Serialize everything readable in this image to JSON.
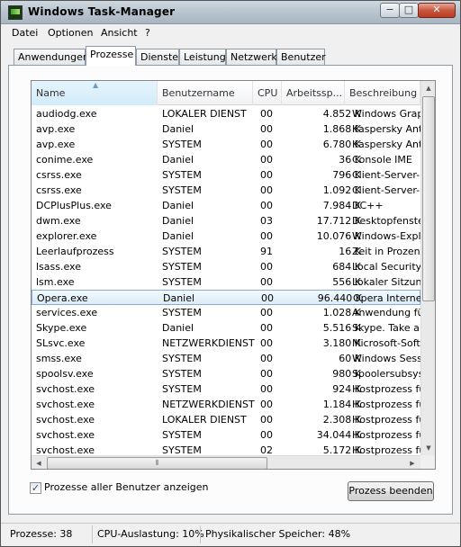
{
  "window": {
    "title": "Windows Task-Manager"
  },
  "caption": {
    "minimize": "−",
    "maximize": "□",
    "close": "✕"
  },
  "menu": [
    {
      "label": "Datei"
    },
    {
      "label": "Optionen"
    },
    {
      "label": "Ansicht"
    },
    {
      "label": "?"
    }
  ],
  "tabs": [
    {
      "label": "Anwendungen"
    },
    {
      "label": "Prozesse"
    },
    {
      "label": "Dienste"
    },
    {
      "label": "Leistung"
    },
    {
      "label": "Netzwerk"
    },
    {
      "label": "Benutzer"
    }
  ],
  "active_tab": "Prozesse",
  "columns": [
    "Name",
    "Benutzername",
    "CPU",
    "Arbeitssp...",
    "Beschreibung"
  ],
  "processes": [
    [
      "audiodg.exe",
      "LOKALER DIENST",
      "00",
      "4.852 K",
      "Windows Graphi"
    ],
    [
      "avp.exe",
      "Daniel",
      "00",
      "1.868 K",
      "Kaspersky Anti-V"
    ],
    [
      "avp.exe",
      "SYSTEM",
      "00",
      "6.780 K",
      "Kaspersky Anti-V"
    ],
    [
      "conime.exe",
      "Daniel",
      "00",
      "36 K",
      "Console IME"
    ],
    [
      "csrss.exe",
      "SYSTEM",
      "00",
      "796 K",
      "Client-Server-La"
    ],
    [
      "csrss.exe",
      "SYSTEM",
      "00",
      "1.092 K",
      "Client-Server-La"
    ],
    [
      "DCPlusPlus.exe",
      "Daniel",
      "00",
      "7.984 K",
      "DC++"
    ],
    [
      "dwm.exe",
      "Daniel",
      "03",
      "17.712 K",
      "Desktopfenster-"
    ],
    [
      "explorer.exe",
      "Daniel",
      "00",
      "10.076 K",
      "Windows-Explor"
    ],
    [
      "Leerlaufprozess",
      "SYSTEM",
      "91",
      "16 K",
      "Zeit in Prozent, c"
    ],
    [
      "lsass.exe",
      "SYSTEM",
      "00",
      "684 K",
      "Local Security Au"
    ],
    [
      "lsm.exe",
      "SYSTEM",
      "00",
      "556 K",
      "Lokaler Sitzungs"
    ],
    [
      "Opera.exe",
      "Daniel",
      "00",
      "96.440 K",
      "Opera Internet B"
    ],
    [
      "services.exe",
      "SYSTEM",
      "00",
      "1.028 K",
      "Anwendung für"
    ],
    [
      "Skype.exe",
      "Daniel",
      "00",
      "5.516 K",
      "Skype. Take a d"
    ],
    [
      "SLsvc.exe",
      "NETZWERKDIENST",
      "00",
      "3.180 K",
      "Microsoft-Softw"
    ],
    [
      "smss.exe",
      "SYSTEM",
      "00",
      "60 K",
      "Windows Session"
    ],
    [
      "spoolsv.exe",
      "SYSTEM",
      "00",
      "980 K",
      "Spoolersubsyste"
    ],
    [
      "svchost.exe",
      "SYSTEM",
      "00",
      "924 K",
      "Hostprozess für"
    ],
    [
      "svchost.exe",
      "NETZWERKDIENST",
      "00",
      "1.184 K",
      "Hostprozess für"
    ],
    [
      "svchost.exe",
      "LOKALER DIENST",
      "00",
      "2.308 K",
      "Hostprozess für"
    ],
    [
      "svchost.exe",
      "SYSTEM",
      "00",
      "34.044 K",
      "Hostprozess für"
    ],
    [
      "svchost.exe",
      "SYSTEM",
      "02",
      "5.172 K",
      "Hostprozess für"
    ]
  ],
  "selected_process": "Opera.exe",
  "show_all_users": {
    "label": "Prozesse aller Benutzer anzeigen",
    "checked": true
  },
  "end_process_button": "Prozess beenden",
  "status": {
    "processes": "Prozesse: 38",
    "cpu": "CPU-Auslastung: 10%",
    "memory": "Physikalischer Speicher: 48%"
  }
}
